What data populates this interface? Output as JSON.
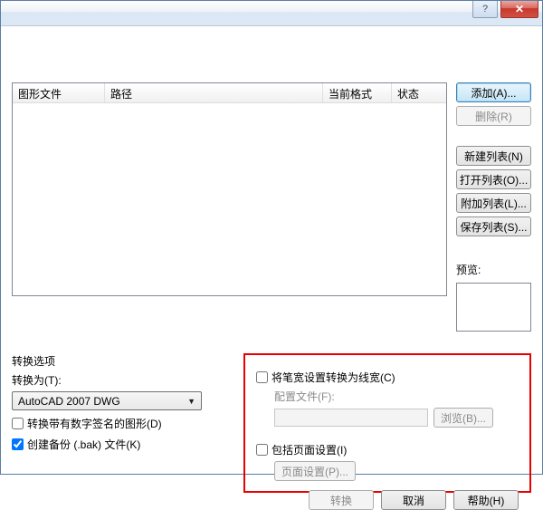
{
  "titlebar": {
    "help_symbol": "?",
    "close_symbol": "✕"
  },
  "table": {
    "headers": {
      "c1": "图形文件",
      "c2": "路径",
      "c3": "当前格式",
      "c4": "状态"
    }
  },
  "side": {
    "add": "添加(A)...",
    "remove": "删除(R)",
    "new_list": "新建列表(N)",
    "open_list": "打开列表(O)...",
    "append_list": "附加列表(L)...",
    "save_list": "保存列表(S)...",
    "preview_label": "预览:"
  },
  "convert": {
    "section_title": "转换选项",
    "convert_as_label": "转换为(T):",
    "format_selected": "AutoCAD 2007 DWG",
    "digital_sig": "转换带有数字签名的图形(D)",
    "create_backup": "创建备份 (.bak) 文件(K)"
  },
  "right_panel": {
    "pen_to_lineweight": "将笔宽设置转换为线宽(C)",
    "config_file_label": "配置文件(F):",
    "browse": "浏览(B)...",
    "include_page_setup": "包括页面设置(I)",
    "page_setup": "页面设置(P)..."
  },
  "footer": {
    "convert": "转换",
    "cancel": "取消",
    "help": "帮助(H)"
  }
}
